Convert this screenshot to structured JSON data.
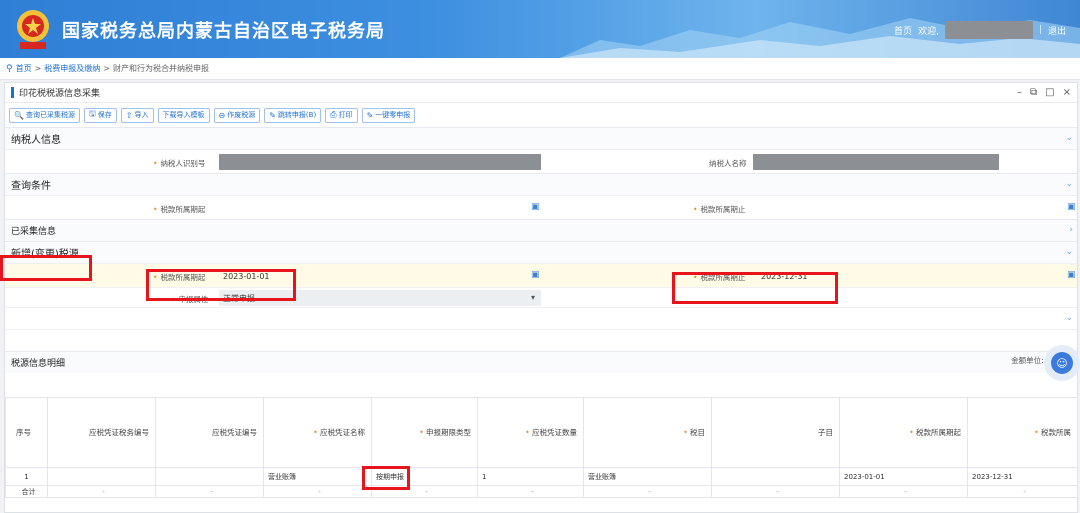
{
  "header": {
    "title": "国家税务总局内蒙古自治区电子税务局",
    "home": "首页",
    "welcome": "欢迎,",
    "logout": "退出"
  },
  "breadcrumb": {
    "home": "首页",
    "level1": "税费申报及缴纳",
    "current": "财产和行为税合并纳税申报"
  },
  "panel": {
    "title": "印花税税源信息采集"
  },
  "toolbar": [
    {
      "icon": "search-icon",
      "glyph": "🔍",
      "label": "查询已采集税源"
    },
    {
      "icon": "save-icon",
      "glyph": "🖫",
      "label": "保存"
    },
    {
      "icon": "import-icon",
      "glyph": "⇧",
      "label": "导入"
    },
    {
      "icon": "",
      "glyph": "",
      "label": "下载导入模板"
    },
    {
      "icon": "void-icon",
      "glyph": "⊖",
      "label": "作废税源"
    },
    {
      "icon": "edit-icon",
      "glyph": "✎",
      "label": "跳转申报(B)"
    },
    {
      "icon": "print-icon",
      "glyph": "⎙",
      "label": "打印"
    },
    {
      "icon": "edit-icon",
      "glyph": "✎",
      "label": "一键零申报"
    }
  ],
  "taxpayer": {
    "section": "纳税人信息",
    "id_label": "纳税人识别号",
    "name_label": "纳税人名称"
  },
  "query": {
    "section": "查询条件",
    "start_label": "税款所属期起",
    "end_label": "税款所属期止"
  },
  "collected": {
    "section": "已采集信息"
  },
  "newsrc": {
    "section": "新增(变更)税源",
    "start_label": "税款所属期起",
    "start_value": "2023-01-01",
    "end_label": "税款所属期止",
    "end_value": "2023-12-31",
    "attr_label": "申报属性",
    "attr_value": "正常申报"
  },
  "unit": "金额单位: 元（列至",
  "detail": {
    "section": "税源信息明细",
    "columns": [
      "序号",
      "应税凭证税务编号",
      "应税凭证编号",
      "应税凭证名称",
      "申报期限类型",
      "应税凭证数量",
      "税目",
      "子目",
      "税款所属期起",
      "税款所属"
    ],
    "row": [
      "1",
      "",
      "",
      "营业账簿",
      "按期申报",
      "1",
      "营业账簿",
      "",
      "2023-01-01",
      "2023-12-31"
    ],
    "total": [
      "合计",
      "-",
      "-",
      "-",
      "-",
      "-",
      "-",
      "-",
      "-",
      "-"
    ]
  },
  "colors": {
    "accent": "#1d6fd1",
    "highlight": "#e8141b",
    "required": "#f08a24"
  }
}
